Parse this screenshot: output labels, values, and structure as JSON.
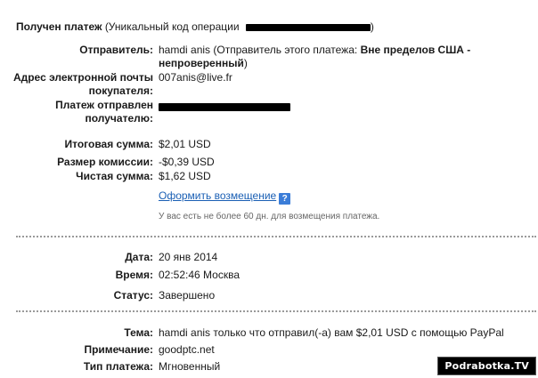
{
  "header": {
    "title": "Получен платеж",
    "code_label": "(Уникальный код операции",
    "code_close": ")"
  },
  "details": {
    "sender_label": "Отправитель:",
    "sender_name": "hamdi anis",
    "sender_note_prefix": "(Отправитель этого платежа:",
    "sender_note_bold": "Вне пределов США - непроверенный",
    "sender_note_suffix": ")",
    "email_label_1": "Адрес электронной почты",
    "email_label_2": "покупателя:",
    "email_value": "007anis@live.fr",
    "sent_to_label_1": "Платеж отправлен",
    "sent_to_label_2": "получателю:"
  },
  "amounts": {
    "total_label": "Итоговая сумма:",
    "total_value": "$2,01 USD",
    "fee_label": "Размер комиссии:",
    "fee_value": "-$0,39 USD",
    "net_label": "Чистая сумма:",
    "net_value": "$1,62 USD",
    "refund_link": "Оформить возмещение",
    "help_icon": "?",
    "refund_note": "У вас есть не более 60 дн. для возмещения платежа."
  },
  "meta": {
    "date_label": "Дата:",
    "date_value": "20 янв 2014",
    "time_label": "Время:",
    "time_value": "02:52:46 Москва",
    "status_label": "Статус:",
    "status_value": "Завершено"
  },
  "message": {
    "subject_label": "Тема:",
    "subject_value": "hamdi anis только что отправил(-а) вам $2,01 USD с помощью PayPal",
    "note_label": "Примечание:",
    "note_value": "goodptc.net",
    "type_label": "Тип платежа:",
    "type_value": "Мгновенный"
  },
  "watermark": "Podrabotka.TV",
  "colors": {
    "link": "#1a5fb4",
    "help_icon": "#3b7dd8",
    "divider": "#9a9a9a"
  }
}
